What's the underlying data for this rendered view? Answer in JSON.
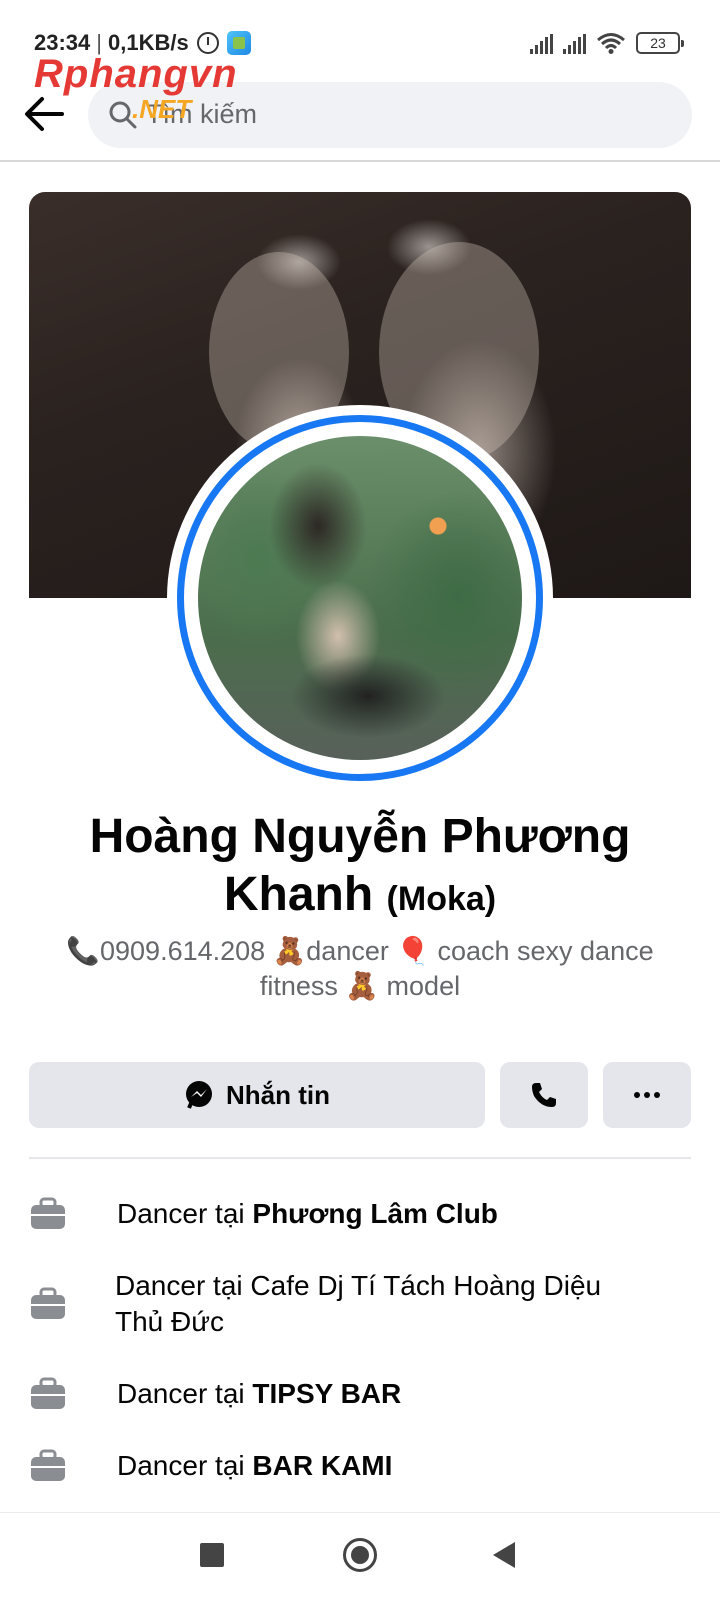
{
  "status_bar": {
    "time": "23:34",
    "speed": "0,1KB/s",
    "battery": "23"
  },
  "header": {
    "search_placeholder": "Tìm kiếm"
  },
  "watermark": {
    "top": "Rphangvn",
    "bottom": ".NET"
  },
  "profile": {
    "name": "Hoàng Nguyễn Phương Khanh",
    "nickname": "(Moka)",
    "bio": "📞0909.614.208 🧸dancer 🎈 coach sexy dance fitness 🧸 model"
  },
  "actions": {
    "message_label": "Nhắn tin",
    "call_icon": "phone-icon",
    "more_icon": "more-icon"
  },
  "work": [
    {
      "prefix": "Dancer tại ",
      "place": "Phương Lâm Club",
      "bold": true
    },
    {
      "prefix": "Dancer tại ",
      "place": "Cafe Dj Tí Tách Hoàng Diệu Thủ Đức",
      "bold": false
    },
    {
      "prefix": "Dancer tại ",
      "place": "TIPSY BAR",
      "bold": true
    },
    {
      "prefix": "Dancer tại ",
      "place": "BAR KAMI",
      "bold": true
    }
  ],
  "colors": {
    "accent": "#1877f2",
    "button_bg": "#e4e6eb",
    "secondary_text": "#65676b"
  }
}
